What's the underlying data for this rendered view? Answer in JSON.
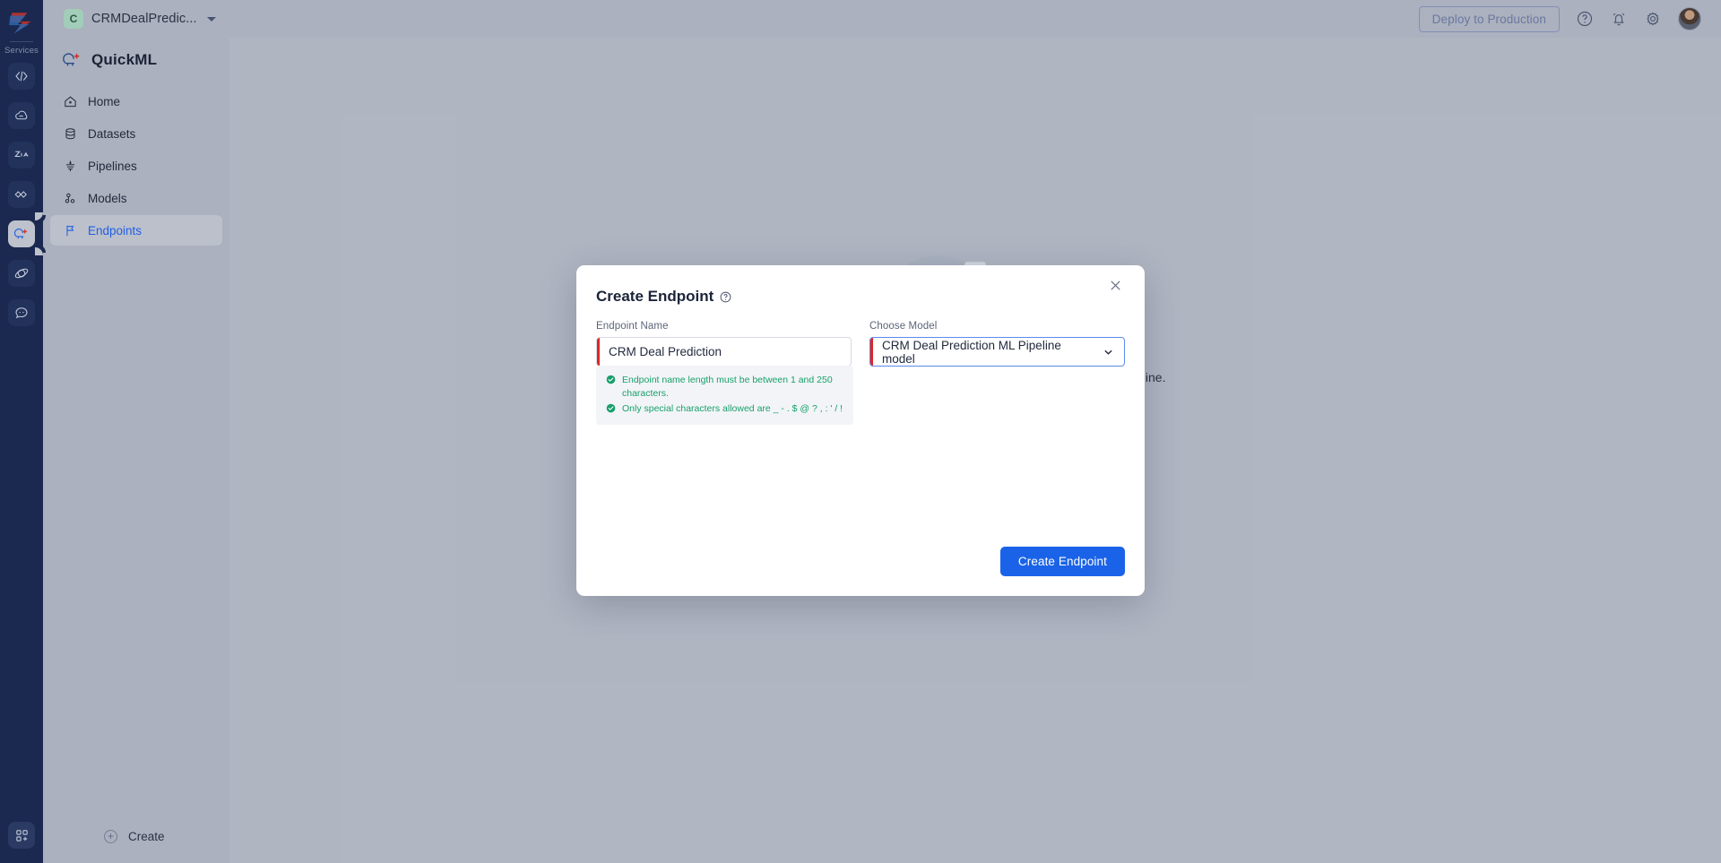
{
  "rail": {
    "services_label": "Services",
    "logo_icon": "zoho-logo-icon",
    "items": [
      {
        "icon": "code-service-icon",
        "name": "service-catalyst",
        "active": false
      },
      {
        "icon": "cloud-service-icon",
        "name": "service-cloud",
        "active": false
      },
      {
        "icon": "zia-service-icon",
        "name": "service-zia",
        "active": false
      },
      {
        "icon": "link-service-icon",
        "name": "service-flow",
        "active": false
      },
      {
        "icon": "quickml-service-icon",
        "name": "service-quickml",
        "active": true
      },
      {
        "icon": "orbit-service-icon",
        "name": "service-orbit",
        "active": false
      },
      {
        "icon": "chat-service-icon",
        "name": "service-chat",
        "active": false
      }
    ],
    "bottom_icon": "apps-grid-plus-icon"
  },
  "topbar": {
    "project_initial": "C",
    "project_name": "CRMDealPredic...",
    "dropdown_icon": "chevron-down-icon",
    "deploy_label": "Deploy to Production",
    "help_icon": "question-circle-icon",
    "notification_icon": "bell-icon",
    "settings_icon": "gear-icon",
    "avatar": "user-avatar"
  },
  "sidebar": {
    "brand": "QuickML",
    "brand_icon": "quickml-logo-icon",
    "items": [
      {
        "label": "Home",
        "icon": "home-icon",
        "active": false
      },
      {
        "label": "Datasets",
        "icon": "database-icon",
        "active": false
      },
      {
        "label": "Pipelines",
        "icon": "funnel-icon",
        "active": false
      },
      {
        "label": "Models",
        "icon": "models-icon",
        "active": false
      },
      {
        "label": "Endpoints",
        "icon": "flag-icon",
        "active": true
      }
    ],
    "create_label": "Create",
    "create_icon": "plus-circle-icon"
  },
  "canvas": {
    "empty_text": "Create an endpoint to make predictions using the published pipeline.",
    "empty_cta": "Create Endpoint",
    "illustration": "folders-data-transfer-illustration"
  },
  "modal": {
    "title": "Create Endpoint",
    "title_help_icon": "question-circle-icon",
    "close_icon": "close-icon",
    "endpoint_name": {
      "label": "Endpoint Name",
      "value": "CRM Deal Prediction",
      "placeholder": "Endpoint Name"
    },
    "choose_model": {
      "label": "Choose Model",
      "value": "CRM Deal Prediction ML Pipeline model",
      "chevron_icon": "chevron-down-icon"
    },
    "hints": [
      {
        "icon": "check-circle-icon",
        "text": "Endpoint name length must be between 1 and 250 characters."
      },
      {
        "icon": "check-circle-icon",
        "text": "Only special characters allowed are _ - . $ @ ? , : ' / !"
      }
    ],
    "submit_label": "Create Endpoint"
  },
  "colors": {
    "primary": "#1a63e8",
    "rail_bg": "#1b2a52",
    "chrome_bg": "#b4bac7",
    "canvas_bg": "#b9bfcb",
    "success": "#18a06a",
    "error_bar": "#e02424",
    "focus_border": "#5a8bea"
  }
}
